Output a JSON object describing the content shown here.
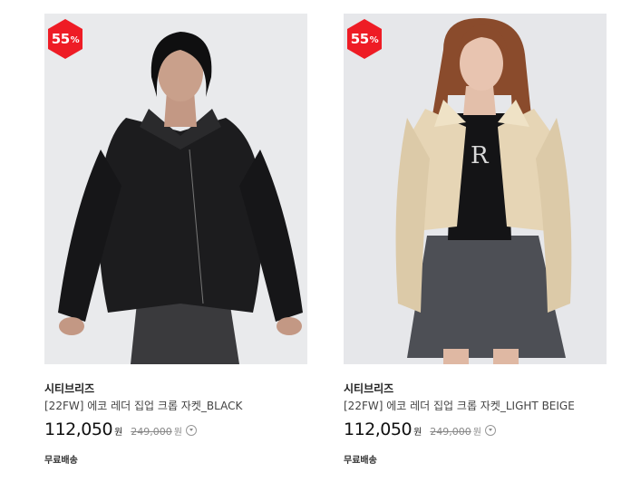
{
  "products": [
    {
      "discount_value": "55",
      "discount_suffix": "%",
      "brand": "시티브리즈",
      "title": "[22FW] 에코 레더 집업 크롭 자켓_BLACK",
      "price": "112,050",
      "price_unit": "원",
      "original_price": "249,000",
      "original_price_unit": "원",
      "shipping": "무료배송",
      "jacket_color": "#1c1c1e",
      "badge_color": "#ee1c25"
    },
    {
      "discount_value": "55",
      "discount_suffix": "%",
      "brand": "시티브리즈",
      "title": "[22FW] 에코 레더 집업 크롭 자켓_LIGHT BEIGE",
      "price": "112,050",
      "price_unit": "원",
      "original_price": "249,000",
      "original_price_unit": "원",
      "shipping": "무료배송",
      "jacket_color": "#e6d5b5",
      "badge_color": "#ee1c25"
    }
  ]
}
